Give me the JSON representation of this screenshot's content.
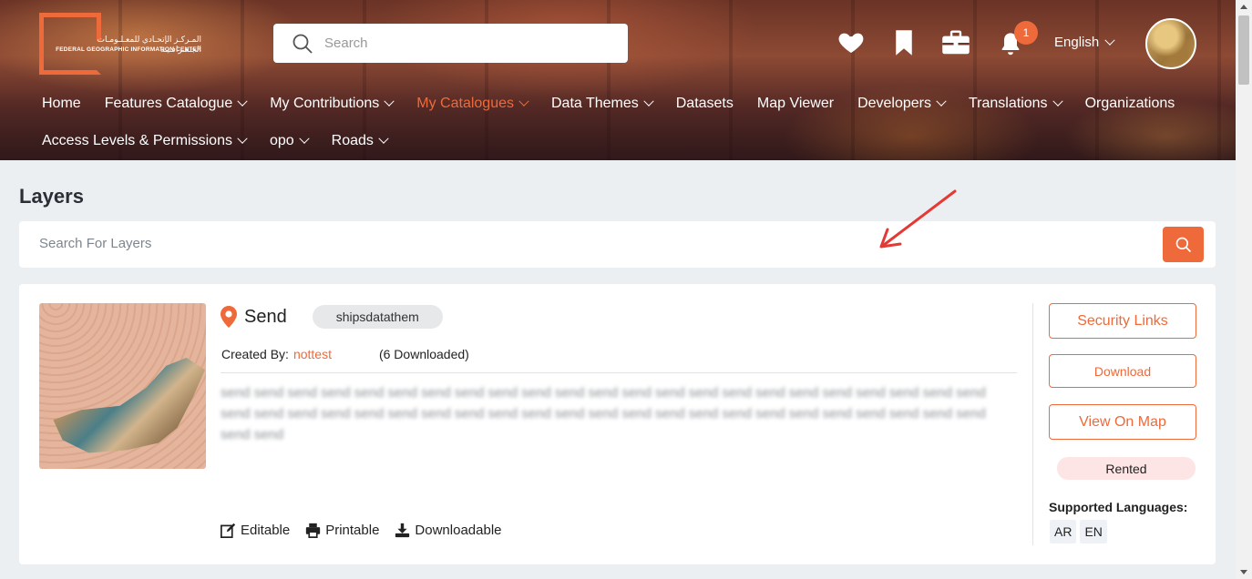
{
  "header": {
    "logo_arabic": "المـركـز الإتحـادي للمعـلـومـات الجـغـرافـيـة",
    "logo_english": "FEDERAL GEOGRAPHIC INFORMATION CENTER",
    "search_placeholder": "Search",
    "notification_count": "1",
    "language": "English",
    "icons": [
      "heart-icon",
      "bookmark-icon",
      "toolbox-icon",
      "bell-icon"
    ]
  },
  "nav": {
    "row1": [
      {
        "label": "Home",
        "dropdown": false
      },
      {
        "label": "Features Catalogue",
        "dropdown": true
      },
      {
        "label": "My Contributions",
        "dropdown": true
      },
      {
        "label": "My Catalogues",
        "dropdown": true,
        "active": true
      },
      {
        "label": "Data Themes",
        "dropdown": true
      },
      {
        "label": "Datasets",
        "dropdown": false
      },
      {
        "label": "Map Viewer",
        "dropdown": false
      },
      {
        "label": "Developers",
        "dropdown": true
      },
      {
        "label": "Translations",
        "dropdown": true
      },
      {
        "label": "Organizations",
        "dropdown": false
      }
    ],
    "row2": [
      {
        "label": "Access Levels & Permissions",
        "dropdown": true
      },
      {
        "label": "opo",
        "dropdown": true
      },
      {
        "label": "Roads",
        "dropdown": true
      }
    ]
  },
  "page": {
    "title": "Layers",
    "search_placeholder": "Search For Layers"
  },
  "layer": {
    "name": "Send",
    "tag": "shipsdatathem",
    "created_by_label": "Created By:",
    "created_by": "nottest",
    "downloads": "(6 Downloaded)",
    "description": "send send send send send send send send send send send send send send send send send send send send send send send send send send send send send send send send send send send send send send send send send send send send send send send send",
    "features": {
      "editable": "Editable",
      "printable": "Printable",
      "downloadable": "Downloadable"
    },
    "actions": {
      "security_links": "Security Links",
      "download": "Download",
      "view_on_map": "View On Map"
    },
    "status": "Rented",
    "languages_label": "Supported Languages:",
    "languages": [
      "AR",
      "EN"
    ]
  },
  "colors": {
    "accent": "#ee6a3a",
    "page_bg": "#eceff2",
    "status_bg": "#fde5e5",
    "annotation_arrow": "#e53935"
  }
}
